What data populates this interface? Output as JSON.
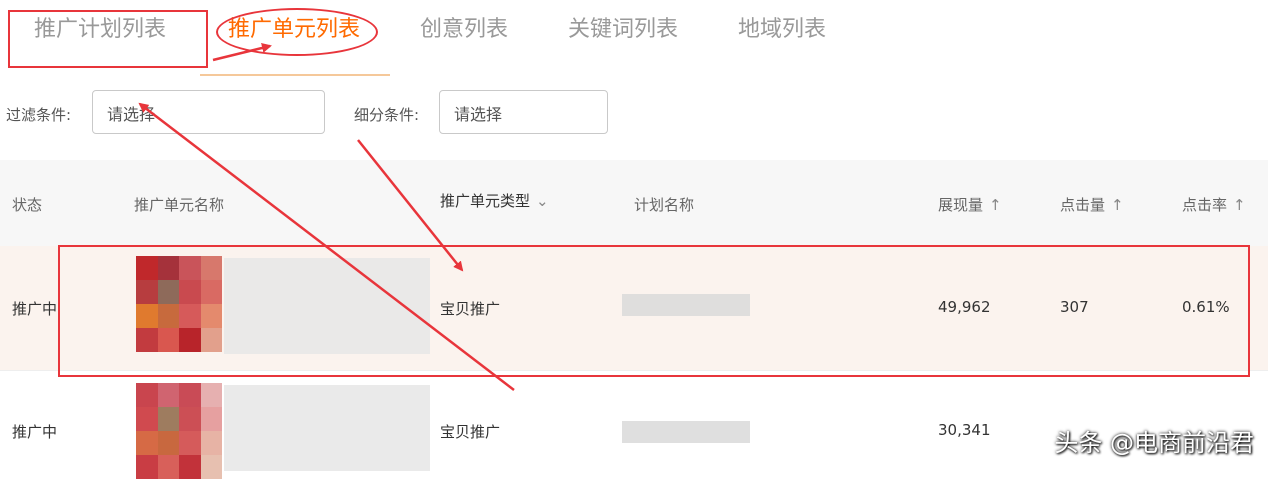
{
  "tabs": [
    {
      "label": "推广计划列表"
    },
    {
      "label": "推广单元列表"
    },
    {
      "label": "创意列表"
    },
    {
      "label": "关键词列表"
    },
    {
      "label": "地域列表"
    }
  ],
  "filters": {
    "filter_label": "过滤条件:",
    "filter_value": "请选择",
    "segment_label": "细分条件:",
    "segment_value": "请选择"
  },
  "table": {
    "columns": [
      "状态",
      "推广单元名称",
      "推广单元类型",
      "计划名称",
      "展现量",
      "点击量",
      "点击率"
    ],
    "rows": [
      {
        "status": "推广中",
        "type": "宝贝推广",
        "impressions": "49,962",
        "clicks": "307",
        "ctr": "0.61%"
      },
      {
        "status": "推广中",
        "type": "宝贝推广",
        "impressions": "30,341",
        "clicks": "",
        "ctr": ""
      }
    ]
  },
  "icons": {
    "sort": "sort-up-arrow",
    "dropdown": "chevron-down-icon"
  },
  "colors": {
    "active_tab": "#ff6a00",
    "annotation_red": "#e8353b",
    "highlight_row": "#fbf3ee"
  },
  "watermark": "头条 @电商前沿君"
}
